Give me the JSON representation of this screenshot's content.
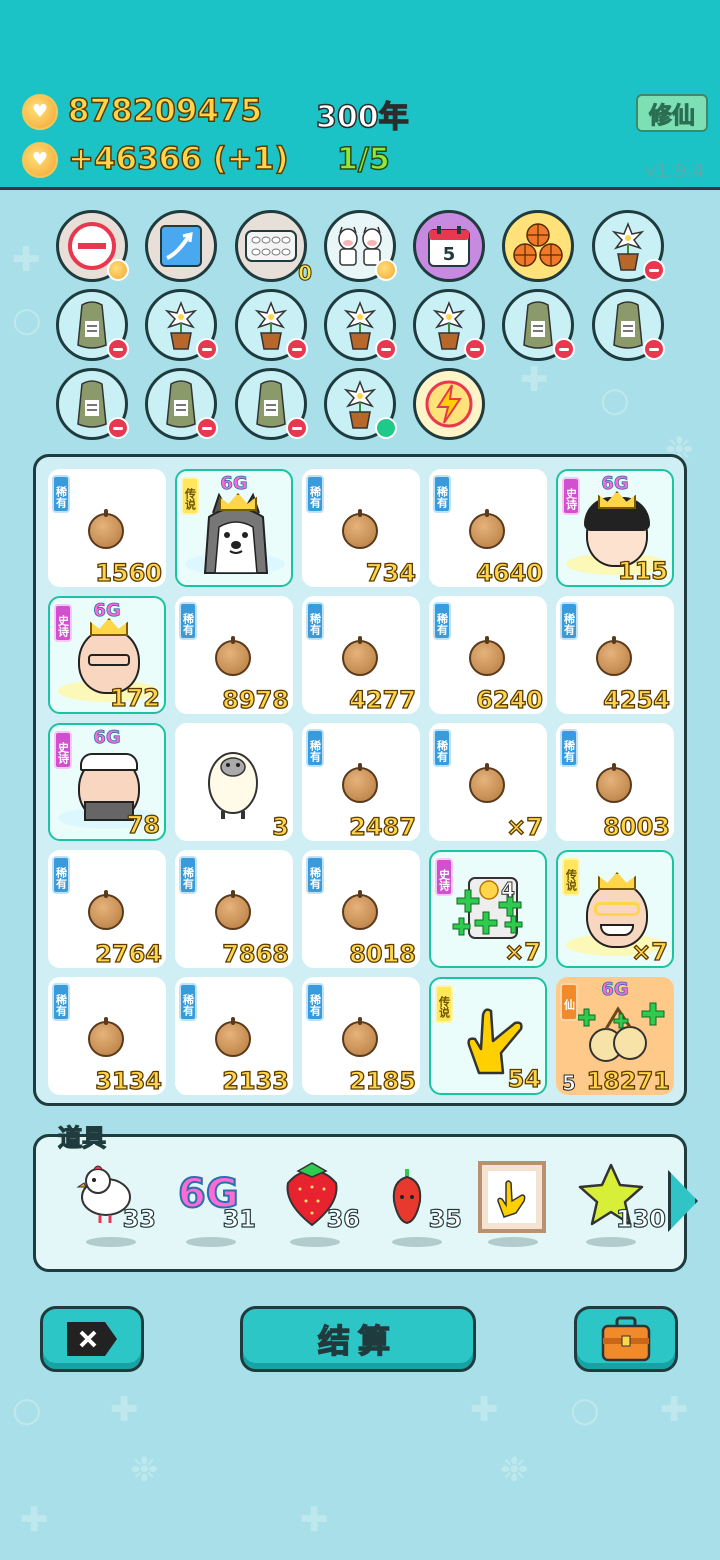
{
  "header": {
    "coins": "878209475",
    "income": "+46366 (+1)",
    "year": "300年",
    "progress": "1/5",
    "cultivate_button": "修仙",
    "version": "v1.9.4"
  },
  "buffs": [
    {
      "icon": "no-entry-icon",
      "badge": "coin"
    },
    {
      "icon": "growth-arrow-icon",
      "badge": ""
    },
    {
      "icon": "egg-tray-icon",
      "badge": "0"
    },
    {
      "icon": "cow-pair-icon",
      "badge": "coin"
    },
    {
      "icon": "calendar-icon",
      "badge": "5"
    },
    {
      "icon": "basketballs-icon",
      "badge": ""
    },
    {
      "icon": "flower-pot-icon",
      "badge": "minus"
    },
    {
      "icon": "seed-bag-icon",
      "badge": "minus"
    },
    {
      "icon": "flower-pot-icon",
      "badge": "minus"
    },
    {
      "icon": "flower-pot-icon",
      "badge": "minus"
    },
    {
      "icon": "flower-pot-icon",
      "badge": "minus"
    },
    {
      "icon": "flower-pot-icon",
      "badge": "minus"
    },
    {
      "icon": "seed-bag-icon",
      "badge": "minus"
    },
    {
      "icon": "seed-bag-icon",
      "badge": "minus"
    },
    {
      "icon": "seed-bag-icon",
      "badge": "minus"
    },
    {
      "icon": "seed-bag-icon",
      "badge": "minus"
    },
    {
      "icon": "seed-bag-icon",
      "badge": "minus"
    },
    {
      "icon": "flower-pot-icon",
      "badge": "green"
    },
    {
      "icon": "lightning-icon",
      "badge": ""
    }
  ],
  "board": [
    {
      "tag": "稀有",
      "type": "rare",
      "kind": "seed",
      "count": "1560"
    },
    {
      "tag": "传说",
      "type": "legend",
      "kind": "husky",
      "count": "",
      "g6": "6G"
    },
    {
      "tag": "稀有",
      "type": "rare",
      "kind": "seed",
      "count": "734"
    },
    {
      "tag": "稀有",
      "type": "rare",
      "kind": "seed",
      "count": "4640"
    },
    {
      "tag": "史诗",
      "type": "epic",
      "kind": "girl",
      "count": "115",
      "g6": "6G"
    },
    {
      "tag": "史诗",
      "type": "epic",
      "kind": "old-man",
      "count": "172",
      "g6": "6G"
    },
    {
      "tag": "稀有",
      "type": "rare",
      "kind": "seed",
      "count": "8978"
    },
    {
      "tag": "稀有",
      "type": "rare",
      "kind": "seed",
      "count": "4277"
    },
    {
      "tag": "稀有",
      "type": "rare",
      "kind": "seed",
      "count": "6240"
    },
    {
      "tag": "稀有",
      "type": "rare",
      "kind": "seed",
      "count": "4254"
    },
    {
      "tag": "史诗",
      "type": "epic",
      "kind": "chef",
      "count": "78",
      "g6": "6G"
    },
    {
      "tag": "",
      "type": "",
      "kind": "sheep",
      "count": "3"
    },
    {
      "tag": "稀有",
      "type": "rare",
      "kind": "seed",
      "count": "2487"
    },
    {
      "tag": "稀有",
      "type": "rare",
      "kind": "seed",
      "count": "×7"
    },
    {
      "tag": "稀有",
      "type": "rare",
      "kind": "seed",
      "count": "8003"
    },
    {
      "tag": "稀有",
      "type": "rare",
      "kind": "seed",
      "count": "2764"
    },
    {
      "tag": "稀有",
      "type": "rare",
      "kind": "seed",
      "count": "7868"
    },
    {
      "tag": "稀有",
      "type": "rare",
      "kind": "seed",
      "count": "8018"
    },
    {
      "tag": "史诗",
      "type": "epic",
      "kind": "coin-machine",
      "count": "×7",
      "inner": "4"
    },
    {
      "tag": "传说",
      "type": "legend",
      "kind": "king",
      "count": "×7"
    },
    {
      "tag": "稀有",
      "type": "rare",
      "kind": "seed",
      "count": "3134"
    },
    {
      "tag": "稀有",
      "type": "rare",
      "kind": "seed",
      "count": "2133"
    },
    {
      "tag": "稀有",
      "type": "rare",
      "kind": "seed",
      "count": "2185"
    },
    {
      "tag": "传说",
      "type": "legend",
      "kind": "pointing-hand",
      "count": "54"
    },
    {
      "tag": "仙",
      "type": "immortal",
      "kind": "pears",
      "count": "18271",
      "level": "5",
      "g6": "6G"
    }
  ],
  "items": {
    "title": "道具",
    "list": [
      {
        "icon": "bird-icon",
        "qty": "33"
      },
      {
        "icon": "6g-icon",
        "label": "6G",
        "qty": "31"
      },
      {
        "icon": "strawberry-icon",
        "qty": "36"
      },
      {
        "icon": "chili-icon",
        "qty": "35"
      },
      {
        "icon": "frame-hand-icon",
        "qty": ""
      },
      {
        "icon": "star-icon",
        "qty": "130"
      }
    ]
  },
  "buttons": {
    "close": "close-icon",
    "settle": "结算",
    "bag": "briefcase-icon"
  },
  "colors": {
    "header": "#1cc3c6",
    "background": "#a9dfe8",
    "gold_text": "#ffd54a",
    "rare": "#3a9bdc",
    "epic": "#d24fd0",
    "legend": "#ffe65a"
  }
}
